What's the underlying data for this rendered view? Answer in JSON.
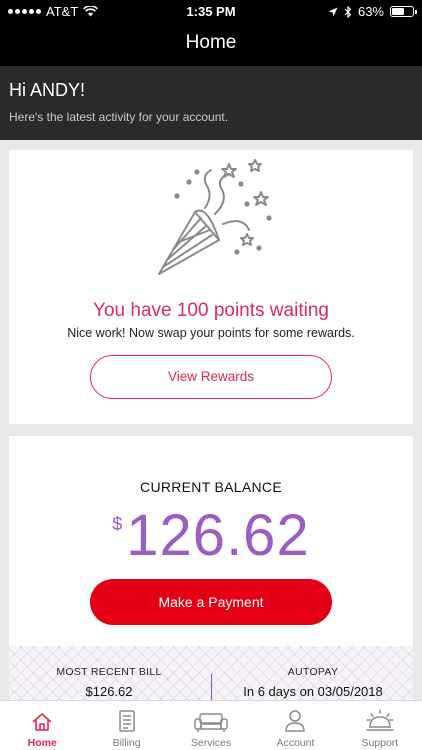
{
  "status": {
    "carrier": "AT&T",
    "time": "1:35 PM",
    "battery": "63%",
    "battery_level": 0.63
  },
  "nav": {
    "title": "Home"
  },
  "greeting": {
    "hi": "Hi ANDY!",
    "sub": "Here's the latest activity for your account."
  },
  "rewards": {
    "icon": "party-popper-icon",
    "title": "You have 100 points waiting",
    "subtitle": "Nice work! Now swap your points for some rewards.",
    "button": "View Rewards"
  },
  "balance": {
    "label": "CURRENT BALANCE",
    "currency": "$",
    "amount": "126.62",
    "pay_button": "Make a Payment",
    "recent_bill_label": "MOST RECENT BILL",
    "recent_bill_value": "$126.62",
    "autopay_label": "AUTOPAY",
    "autopay_value": "In 6 days on 03/05/2018"
  },
  "tabs": [
    {
      "label": "Home",
      "icon": "home-icon",
      "active": true
    },
    {
      "label": "Billing",
      "icon": "bill-icon",
      "active": false
    },
    {
      "label": "Services",
      "icon": "sofa-icon",
      "active": false
    },
    {
      "label": "Account",
      "icon": "person-icon",
      "active": false
    },
    {
      "label": "Support",
      "icon": "service-bell-icon",
      "active": false
    }
  ],
  "colors": {
    "accent": "#e2264b",
    "purple": "#9b5cc4",
    "pay": "#e30016"
  }
}
